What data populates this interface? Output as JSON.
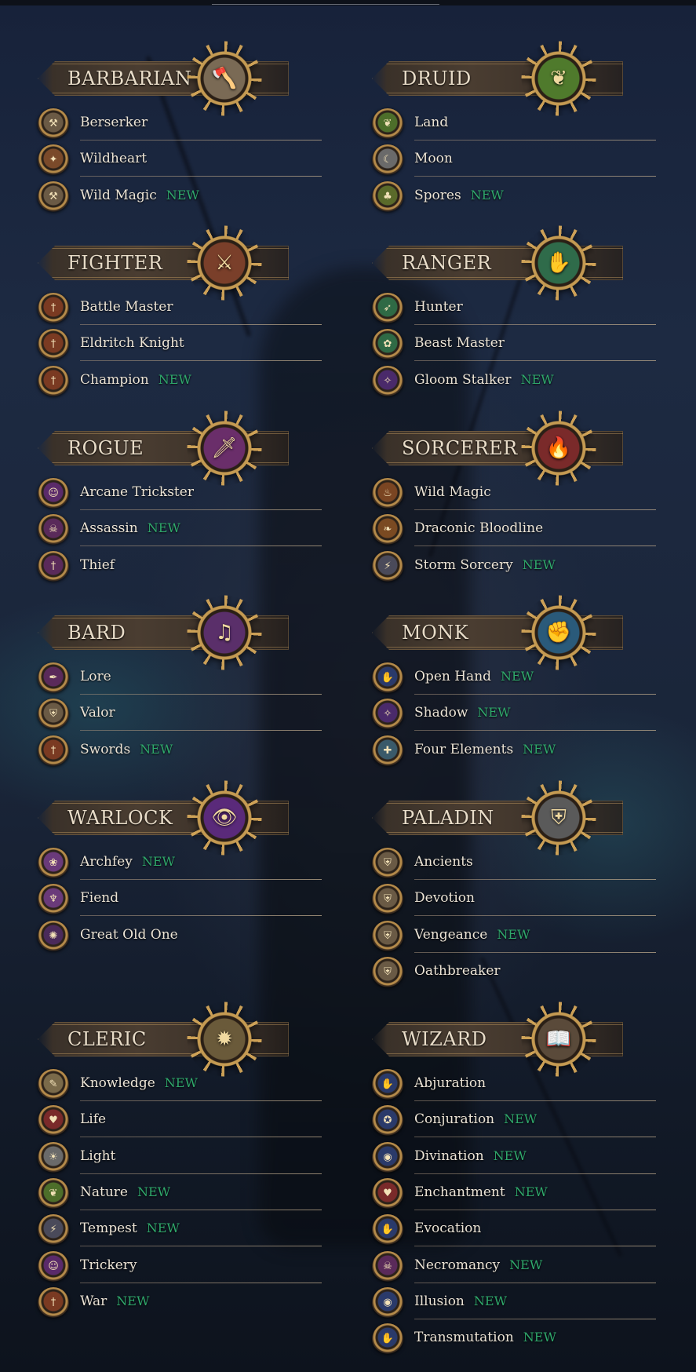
{
  "new_label": "NEW",
  "colors": {
    "new": "#2fa86b",
    "title": "#e8dcc8",
    "text": "#ece4d6",
    "gold": "#c49a52"
  },
  "classes": [
    {
      "id": "barbarian",
      "name": "BARBARIAN",
      "emblem_icon": "axe-icon",
      "emblem_glyph": "🪓",
      "emblem_color": "#7a6a55",
      "subclasses": [
        {
          "name": "Berserker",
          "new": false,
          "icon": "axe-icon"
        },
        {
          "name": "Wildheart",
          "new": false,
          "icon": "beast-icon"
        },
        {
          "name": "Wild Magic",
          "new": true,
          "icon": "axe-icon"
        }
      ]
    },
    {
      "id": "druid",
      "name": "DRUID",
      "emblem_icon": "leaf-icon",
      "emblem_glyph": "❦",
      "emblem_color": "#4f7a2c",
      "subclasses": [
        {
          "name": "Land",
          "new": false,
          "icon": "leaf-icon"
        },
        {
          "name": "Moon",
          "new": false,
          "icon": "moon-icon"
        },
        {
          "name": "Spores",
          "new": true,
          "icon": "mushroom-icon"
        }
      ]
    },
    {
      "id": "fighter",
      "name": "FIGHTER",
      "emblem_icon": "sword-shield-icon",
      "emblem_glyph": "⚔",
      "emblem_color": "#7a3f2a",
      "subclasses": [
        {
          "name": "Battle Master",
          "new": false,
          "icon": "sword-icon"
        },
        {
          "name": "Eldritch Knight",
          "new": false,
          "icon": "sword-icon"
        },
        {
          "name": "Champion",
          "new": true,
          "icon": "sword-icon"
        }
      ]
    },
    {
      "id": "ranger",
      "name": "RANGER",
      "emblem_icon": "paw-icon",
      "emblem_glyph": "✋",
      "emblem_color": "#2f6b4a",
      "subclasses": [
        {
          "name": "Hunter",
          "new": false,
          "icon": "arrow-icon"
        },
        {
          "name": "Beast Master",
          "new": false,
          "icon": "paw-icon"
        },
        {
          "name": "Gloom Stalker",
          "new": true,
          "icon": "shadow-icon"
        }
      ]
    },
    {
      "id": "rogue",
      "name": "ROGUE",
      "emblem_icon": "dagger-icon",
      "emblem_glyph": "🗡",
      "emblem_color": "#6a2e6a",
      "subclasses": [
        {
          "name": "Arcane Trickster",
          "new": false,
          "icon": "mask-icon"
        },
        {
          "name": "Assassin",
          "new": true,
          "icon": "skull-icon"
        },
        {
          "name": "Thief",
          "new": false,
          "icon": "dagger-icon"
        }
      ]
    },
    {
      "id": "sorcerer",
      "name": "SORCERER",
      "emblem_icon": "flame-icon",
      "emblem_glyph": "🔥",
      "emblem_color": "#7a2a2a",
      "subclasses": [
        {
          "name": "Wild Magic",
          "new": false,
          "icon": "flame-icon"
        },
        {
          "name": "Draconic Bloodline",
          "new": false,
          "icon": "dragon-icon"
        },
        {
          "name": "Storm Sorcery",
          "new": true,
          "icon": "storm-icon"
        }
      ]
    },
    {
      "id": "bard",
      "name": "BARD",
      "emblem_icon": "lute-icon",
      "emblem_glyph": "♫",
      "emblem_color": "#5a2f6a",
      "subclasses": [
        {
          "name": "Lore",
          "new": false,
          "icon": "feather-icon"
        },
        {
          "name": "Valor",
          "new": false,
          "icon": "shield-icon"
        },
        {
          "name": "Swords",
          "new": true,
          "icon": "sword-icon"
        }
      ]
    },
    {
      "id": "monk",
      "name": "MONK",
      "emblem_icon": "fist-icon",
      "emblem_glyph": "✊",
      "emblem_color": "#2a5a7a",
      "subclasses": [
        {
          "name": "Open Hand",
          "new": true,
          "icon": "hand-icon"
        },
        {
          "name": "Shadow",
          "new": true,
          "icon": "shadow-icon"
        },
        {
          "name": "Four Elements",
          "new": true,
          "icon": "elements-icon"
        }
      ]
    },
    {
      "id": "warlock",
      "name": "WARLOCK",
      "emblem_icon": "eye-icon",
      "emblem_glyph": "👁",
      "emblem_color": "#5a2a7a",
      "subclasses": [
        {
          "name": "Archfey",
          "new": true,
          "icon": "fey-icon"
        },
        {
          "name": "Fiend",
          "new": false,
          "icon": "fiend-icon"
        },
        {
          "name": "Great Old One",
          "new": false,
          "icon": "tentacle-icon"
        }
      ]
    },
    {
      "id": "paladin",
      "name": "PALADIN",
      "emblem_icon": "winged-shield-icon",
      "emblem_glyph": "⛨",
      "emblem_color": "#5a5a5a",
      "subclasses": [
        {
          "name": "Ancients",
          "new": false,
          "icon": "shield-icon"
        },
        {
          "name": "Devotion",
          "new": false,
          "icon": "shield-icon"
        },
        {
          "name": "Vengeance",
          "new": true,
          "icon": "shield-icon"
        },
        {
          "name": "Oathbreaker",
          "new": false,
          "icon": "shield-icon"
        }
      ]
    },
    {
      "id": "cleric",
      "name": "CLERIC",
      "emblem_icon": "mace-icon",
      "emblem_glyph": "✹",
      "emblem_color": "#6a5a3a",
      "subclasses": [
        {
          "name": "Knowledge",
          "new": true,
          "icon": "book-icon"
        },
        {
          "name": "Life",
          "new": false,
          "icon": "heart-icon"
        },
        {
          "name": "Light",
          "new": false,
          "icon": "sun-icon"
        },
        {
          "name": "Nature",
          "new": true,
          "icon": "leaf-icon"
        },
        {
          "name": "Tempest",
          "new": true,
          "icon": "storm-icon"
        },
        {
          "name": "Trickery",
          "new": false,
          "icon": "mask-icon"
        },
        {
          "name": "War",
          "new": true,
          "icon": "sword-icon"
        }
      ]
    },
    {
      "id": "wizard",
      "name": "WIZARD",
      "emblem_icon": "spellbook-icon",
      "emblem_glyph": "📖",
      "emblem_color": "#5a4a3a",
      "subclasses": [
        {
          "name": "Abjuration",
          "new": false,
          "icon": "hand-icon"
        },
        {
          "name": "Conjuration",
          "new": true,
          "icon": "conjure-icon"
        },
        {
          "name": "Divination",
          "new": true,
          "icon": "eye-icon"
        },
        {
          "name": "Enchantment",
          "new": true,
          "icon": "heart-icon"
        },
        {
          "name": "Evocation",
          "new": false,
          "icon": "hand-icon"
        },
        {
          "name": "Necromancy",
          "new": true,
          "icon": "skull-icon"
        },
        {
          "name": "Illusion",
          "new": true,
          "icon": "eye-icon"
        },
        {
          "name": "Transmutation",
          "new": true,
          "icon": "hand-icon"
        }
      ]
    }
  ]
}
